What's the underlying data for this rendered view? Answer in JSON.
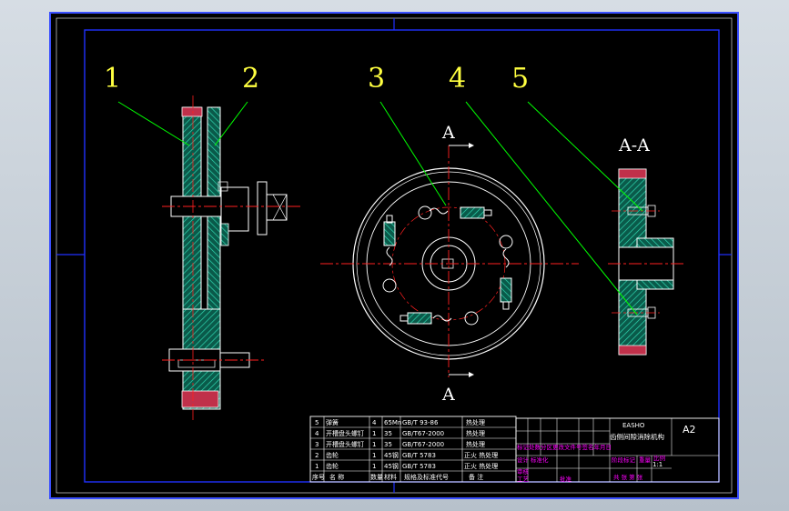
{
  "balloons": [
    "1",
    "2",
    "3",
    "4",
    "5"
  ],
  "section_marks": {
    "top": "A",
    "bottom": "A",
    "view_title": "A-A"
  },
  "bom": {
    "rows": [
      {
        "no": "5",
        "name": "弹簧",
        "qty": "4",
        "material": "65Mn",
        "std": "GB/T 93-86",
        "note": "热处理"
      },
      {
        "no": "4",
        "name": "开槽盘头螺钉",
        "qty": "1",
        "material": "35",
        "std": "GB/T67-2000",
        "note": "热处理"
      },
      {
        "no": "3",
        "name": "开槽盘头螺钉",
        "qty": "1",
        "material": "35",
        "std": "GB/T67-2000",
        "note": "热处理"
      },
      {
        "no": "2",
        "name": "齿轮",
        "qty": "1",
        "material": "45钢",
        "std": "GB/T 5783",
        "note": "正火 热处理"
      },
      {
        "no": "1",
        "name": "齿轮",
        "qty": "1",
        "material": "45钢",
        "std": "GB/T 5783",
        "note": "正火 热处理"
      }
    ],
    "header": {
      "no": "序号",
      "name": "名  称",
      "qty": "数量",
      "material": "材料",
      "std": "规格及标准代号",
      "note": "备  注"
    }
  },
  "title_block": {
    "school": "EASHO",
    "title": "齿侧间隙消除机构",
    "sheet": "A2",
    "scale": "1:1",
    "labels": {
      "design": "设计",
      "check": "审核",
      "process": "工艺",
      "weight": "重量",
      "ratio": "比例",
      "stage_mark": "阶段标记",
      "sheet_info": "共 张 第 张",
      "mark": "标记处数分区更改文件号签名年月日",
      "standard": "标准化",
      "approve": "批准"
    }
  },
  "colors": {
    "bg": "#000000",
    "border": "#0000ff",
    "outline": "#ffffff",
    "hatch": "#00c8a0",
    "center": "#ff0000",
    "leader": "#00ff00",
    "label": "#ffff00",
    "accent": "#ff00ff"
  }
}
